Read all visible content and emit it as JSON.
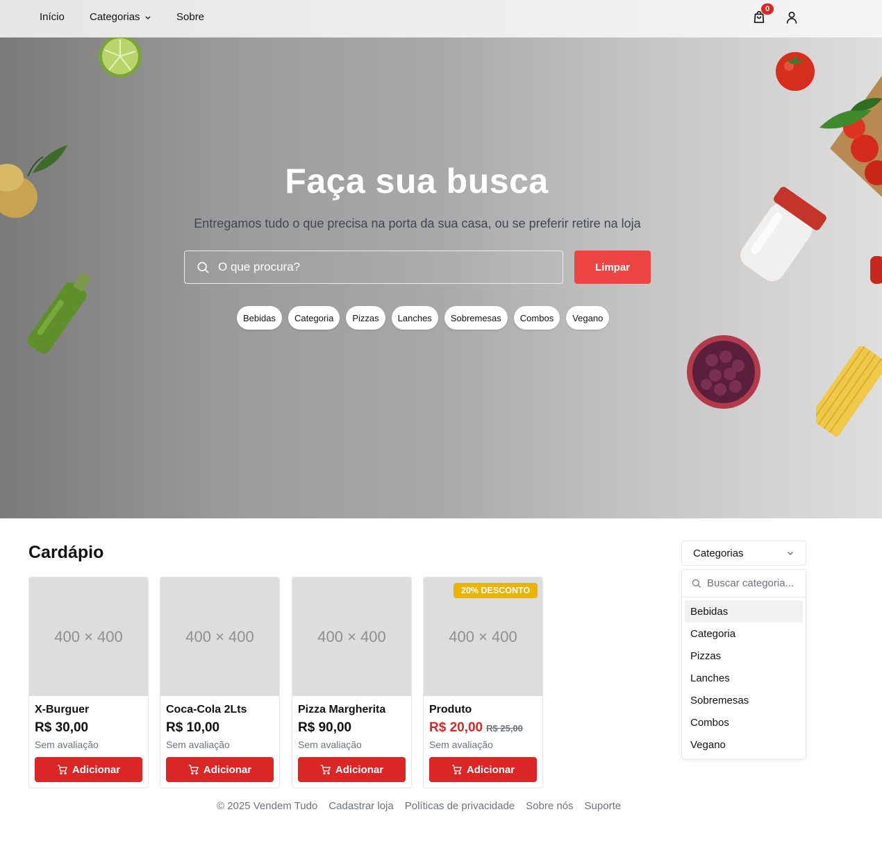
{
  "nav": {
    "home": "Início",
    "categories": "Categorias",
    "about": "Sobre",
    "cart_count": "0"
  },
  "hero": {
    "title": "Faça sua busca",
    "subtitle": "Entregamos tudo o que precisa na porta da sua casa, ou se preferir retire na loja",
    "search_placeholder": "O que procura?",
    "clear_label": "Limpar",
    "chips": [
      "Bebidas",
      "Categoria",
      "Pizzas",
      "Lanches",
      "Sobremesas",
      "Combos",
      "Vegano"
    ]
  },
  "menu": {
    "title": "Cardápio",
    "products": [
      {
        "image": "400 × 400",
        "name": "X-Burguer",
        "price": "R$ 30,00",
        "rating": "Sem avaliação",
        "add_label": "Adicionar"
      },
      {
        "image": "400 × 400",
        "name": "Coca-Cola 2Lts",
        "price": "R$ 10,00",
        "rating": "Sem avaliação",
        "add_label": "Adicionar"
      },
      {
        "image": "400 × 400",
        "name": "Pizza Margherita",
        "price": "R$ 90,00",
        "rating": "Sem avaliação",
        "add_label": "Adicionar"
      },
      {
        "image": "400 × 400",
        "name": "Produto",
        "price": "R$ 20,00",
        "old_price": "R$ 25,00",
        "badge": "20% DESCONTO",
        "rating": "Sem avaliação",
        "add_label": "Adicionar"
      }
    ]
  },
  "category_filter": {
    "selected": "Categorias",
    "search_placeholder": "Buscar categoria...",
    "options": [
      "Bebidas",
      "Categoria",
      "Pizzas",
      "Lanches",
      "Sobremesas",
      "Combos",
      "Vegano"
    ],
    "highlighted": "Bebidas"
  },
  "footer": {
    "copyright": "© 2025 Vendem Tudo",
    "links": [
      "Cadastrar loja",
      "Políticas de privacidade",
      "Sobre nós",
      "Suporte"
    ]
  },
  "colors": {
    "accent": "#dc2626",
    "clear_button": "#ef4444",
    "badge": "#eab308"
  }
}
